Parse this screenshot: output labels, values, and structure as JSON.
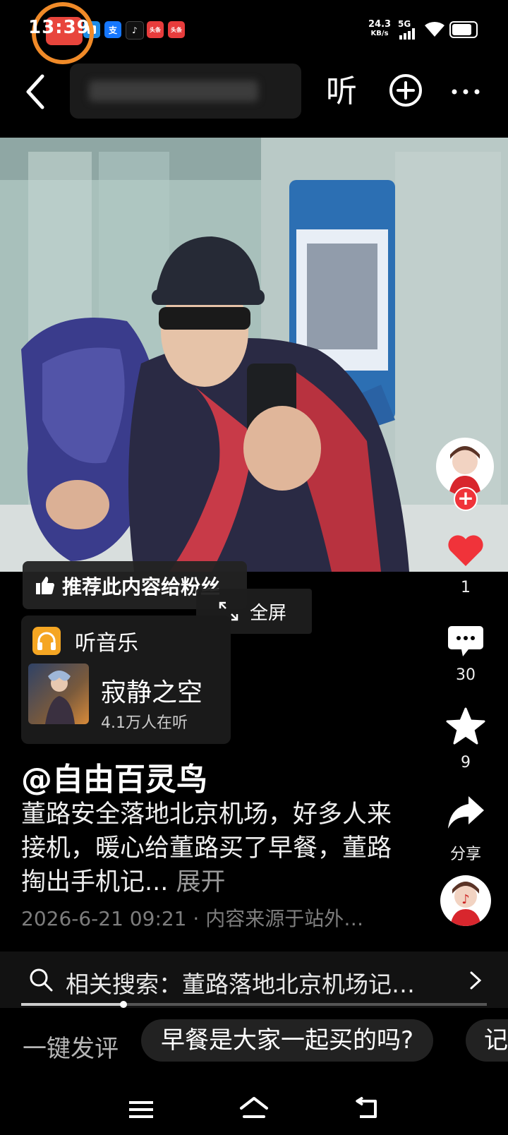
{
  "status_bar": {
    "time": "13:39",
    "app_icons": [
      {
        "name": "blue-app-icon",
        "label": "",
        "color": "#1e8ce6"
      },
      {
        "name": "alipay-icon",
        "label": "支",
        "color": "#1677ff"
      },
      {
        "name": "tiktok-icon",
        "label": "♪",
        "color": "#111111"
      },
      {
        "name": "toutiao-icon",
        "label": "头条",
        "color": "#e73c3c"
      },
      {
        "name": "toutiao-icon-2",
        "label": "头条",
        "color": "#e73c3c"
      }
    ],
    "net_speed_value": "24.3",
    "net_speed_unit": "KB/s",
    "signal": "5G",
    "battery_level": 0.85
  },
  "nav": {
    "listen_label": "听"
  },
  "side_actions": {
    "like_count": "1",
    "comment_count": "30",
    "favorite_count": "9",
    "share_label": "分享"
  },
  "recommend": {
    "label": "推荐此内容给粉丝"
  },
  "fullscreen": {
    "label": "全屏"
  },
  "music": {
    "header": "听音乐",
    "song": "寂静之空",
    "listeners": "4.1万人在听"
  },
  "post": {
    "author": "@自由百灵鸟",
    "description": "董路安全落地北京机场，好多人来接机，暖心给董路买了早餐，董路掏出手机记...",
    "expand_label": "展开",
    "date": "2026-6-21 09:21",
    "source": "· 内容来源于站外…"
  },
  "related_search": {
    "label": "相关搜索：董路落地北京机场记…",
    "progress": 0.22
  },
  "comment_bar": {
    "prompt": "一键发评",
    "suggestion_1": "早餐是大家一起买的吗?",
    "suggestion_2": "记"
  },
  "colors": {
    "accent_red": "#f0333a",
    "record_ring": "#f08a28",
    "music_icon": "#f5a623"
  }
}
